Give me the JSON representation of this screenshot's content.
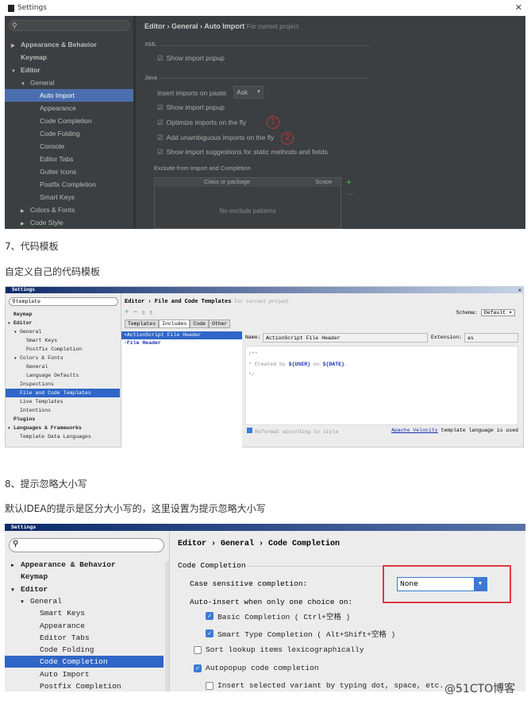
{
  "shot1": {
    "title": "Settings",
    "close": "✕",
    "search": "",
    "sidebar": [
      {
        "label": "Appearance & Behavior",
        "level": 0,
        "arrow": "▶",
        "bold": true
      },
      {
        "label": "Keymap",
        "level": 0,
        "arrow": "",
        "bold": true
      },
      {
        "label": "Editor",
        "level": 0,
        "arrow": "▼",
        "bold": true
      },
      {
        "label": "General",
        "level": 1,
        "arrow": "▼"
      },
      {
        "label": "Auto Import",
        "level": 2,
        "selected": true
      },
      {
        "label": "Appearance",
        "level": 2
      },
      {
        "label": "Code Completion",
        "level": 2
      },
      {
        "label": "Code Folding",
        "level": 2
      },
      {
        "label": "Console",
        "level": 2
      },
      {
        "label": "Editor Tabs",
        "level": 2
      },
      {
        "label": "Gutter Icons",
        "level": 2
      },
      {
        "label": "Postfix Completion",
        "level": 2
      },
      {
        "label": "Smart Keys",
        "level": 2
      },
      {
        "label": "Colors & Fonts",
        "level": 1,
        "arrow": "▶"
      },
      {
        "label": "Code Style",
        "level": 1,
        "arrow": "▶"
      }
    ],
    "breadcrumb": [
      "Editor",
      "General",
      "Auto Import"
    ],
    "for_project": "For current project",
    "xml_group": "XML",
    "xml_show_popup": "Show import popup",
    "java_group": "Java",
    "insert_label": "Insert imports on paste:",
    "insert_value": "Ask",
    "java_options": [
      "Show import popup",
      "Optimize imports on the fly",
      "Add unambiguous imports on the fly",
      "Show import suggestions for static methods and fields"
    ],
    "markers": [
      "1",
      "2"
    ],
    "exclude_group": "Exclude from Import and Completion",
    "col_class": "Class or package",
    "col_scope": "Scope",
    "empty": "No exclude patterns",
    "add": "+",
    "remove": "—"
  },
  "heading7": "7、代码模板",
  "text7": "自定义自己的代码模板",
  "shot2": {
    "title": "Settings",
    "search": "template",
    "sidebar": [
      {
        "label": "Keymap",
        "level": 0,
        "bold": true
      },
      {
        "label": "Editor",
        "level": 0,
        "arrow": "▼",
        "bold": true
      },
      {
        "label": "General",
        "level": 1,
        "arrow": "▼"
      },
      {
        "label": "Smart Keys",
        "level": 2
      },
      {
        "label": "Postfix Completion",
        "level": 2
      },
      {
        "label": "Colors & Fonts",
        "level": 1,
        "arrow": "▼"
      },
      {
        "label": "General",
        "level": 2
      },
      {
        "label": "Language Defaults",
        "level": 2
      },
      {
        "label": "Inspections",
        "level": 1
      },
      {
        "label": "File and Code Templates",
        "level": 1,
        "selected": true
      },
      {
        "label": "Live Templates",
        "level": 1
      },
      {
        "label": "Intentions",
        "level": 1
      },
      {
        "label": "Plugins",
        "level": 0,
        "bold": true
      },
      {
        "label": "Languages & Frameworks",
        "level": 0,
        "arrow": "▼",
        "bold": true
      },
      {
        "label": "Template Data Languages",
        "level": 1
      }
    ],
    "breadcrumb": "Editor › File and Code Templates",
    "for_project": "For current project",
    "schema_label": "Schema:",
    "schema_value": "Default",
    "tabs": [
      "Templates",
      "Includes",
      "Code",
      "Other"
    ],
    "active_tab": 1,
    "templates": [
      "ActionScript File Header",
      "File Header"
    ],
    "name_label": "Name:",
    "name_value": "ActionScript File Header",
    "ext_label": "Extension:",
    "ext_value": "as",
    "code": [
      "/**",
      " * Created by ",
      "${USER}",
      " on ",
      "${DATE}",
      ".",
      " */"
    ],
    "reformat": "Reformat according to style",
    "velocity_link": "Apache Velocity",
    "velocity_text": " template language is used"
  },
  "heading8": "8、提示忽略大小写",
  "text8": "默认IDEA的提示是区分大小写的，这里设置为提示忽略大小写",
  "shot3": {
    "title": "Settings",
    "search": "",
    "sidebar": [
      {
        "label": "Appearance & Behavior",
        "level": 0,
        "arrow": "▶",
        "bold": true
      },
      {
        "label": "Keymap",
        "level": 0,
        "bold": true
      },
      {
        "label": "Editor",
        "level": 0,
        "arrow": "▼",
        "bold": true
      },
      {
        "label": "General",
        "level": 1,
        "arrow": "▼"
      },
      {
        "label": "Smart Keys",
        "level": 2
      },
      {
        "label": "Appearance",
        "level": 2
      },
      {
        "label": "Editor Tabs",
        "level": 2
      },
      {
        "label": "Code Folding",
        "level": 2
      },
      {
        "label": "Code Completion",
        "level": 2,
        "selected": true
      },
      {
        "label": "Auto Import",
        "level": 2
      },
      {
        "label": "Postfix Completion",
        "level": 2
      }
    ],
    "breadcrumb": "Editor › General › Code Completion",
    "group": "Code Completion",
    "case_label": "Case sensitive completion:",
    "case_value": "None",
    "auto_insert": "Auto-insert when only one choice on:",
    "options": [
      {
        "label": "Basic Completion ( Ctrl+空格 )",
        "checked": true
      },
      {
        "label": "Smart Type Completion ( Alt+Shift+空格 )",
        "checked": true
      },
      {
        "label": "Sort lookup items lexicographically",
        "checked": false
      },
      {
        "label": "Autopopup code completion",
        "checked": true
      },
      {
        "label": "Insert selected variant by typing dot, space, etc.",
        "checked": false
      }
    ],
    "highlight_color": "#e0383e"
  },
  "watermark": "@51CTO博客"
}
